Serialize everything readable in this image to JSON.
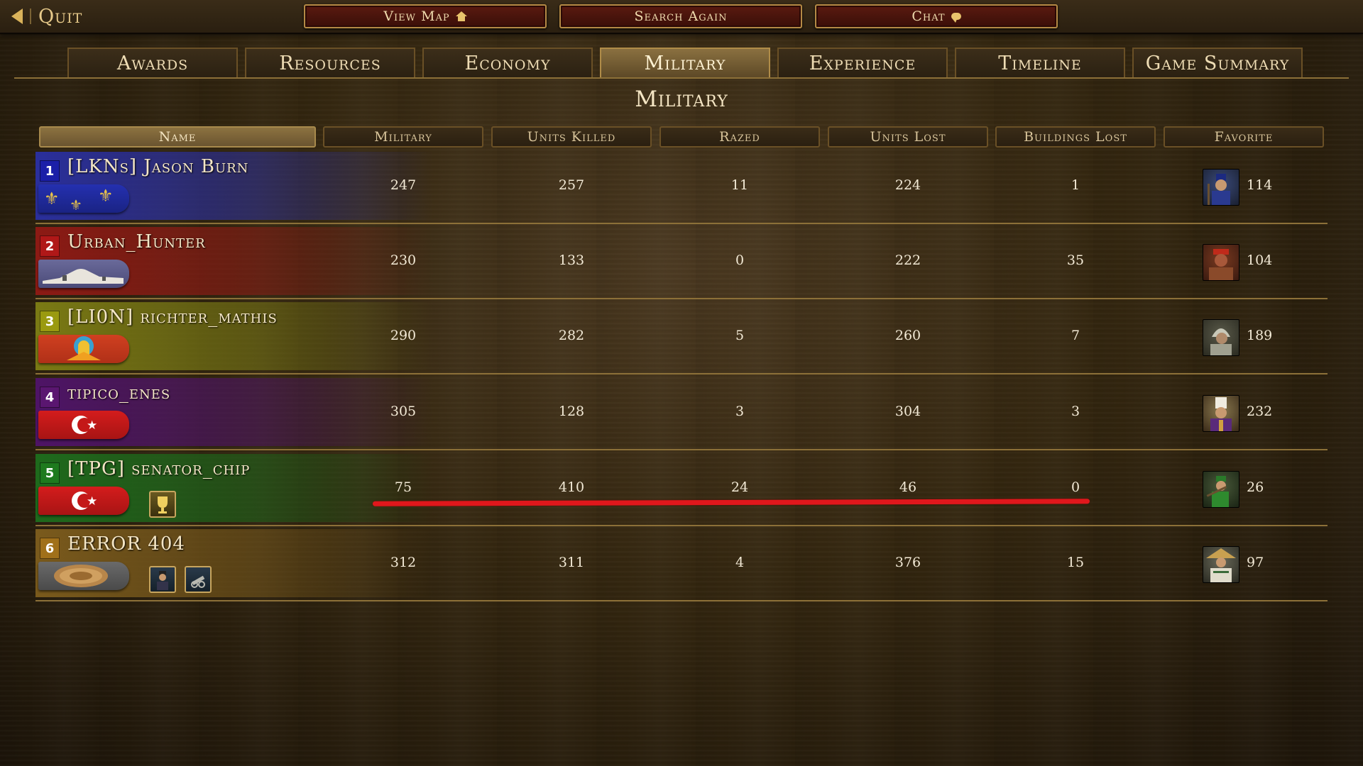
{
  "topbar": {
    "quit_label": "Quit",
    "view_map_label": "View Map",
    "search_again_label": "Search Again",
    "chat_label": "Chat"
  },
  "tabs": [
    {
      "label": "Awards"
    },
    {
      "label": "Resources"
    },
    {
      "label": "Economy"
    },
    {
      "label": "Military",
      "active": true
    },
    {
      "label": "Experience"
    },
    {
      "label": "Timeline"
    },
    {
      "label": "Game Summary"
    }
  ],
  "page_title": "Military",
  "table": {
    "headers": [
      "Name",
      "Military",
      "Units Killed",
      "Razed",
      "Units Lost",
      "Buildings Lost",
      "Favorite"
    ],
    "rows": [
      {
        "rank": "1",
        "name": "[LKNs] Jason Burn",
        "rank_color": "#1b1fa8",
        "band_color": "#2a2f9c",
        "flag": "fleur-de-lis-flag",
        "military": "247",
        "units_killed": "257",
        "razed": "11",
        "units_lost": "224",
        "buildings_lost": "1",
        "favorite_icon": "musketeer-portrait-icon",
        "favorite_count": "114"
      },
      {
        "rank": "2",
        "name": "Urban_Hunter",
        "rank_color": "#b01818",
        "band_color": "#8c1a14",
        "flag": "desert-fortress-flag",
        "military": "230",
        "units_killed": "133",
        "razed": "0",
        "units_lost": "222",
        "buildings_lost": "35",
        "favorite_icon": "warrior-portrait-icon",
        "favorite_count": "104"
      },
      {
        "rank": "3",
        "name": "[LI0N] richter_mathis",
        "rank_color": "#9a9a10",
        "band_color": "#7a7a14",
        "flag": "sun-emblem-flag",
        "military": "290",
        "units_killed": "282",
        "razed": "5",
        "units_lost": "260",
        "buildings_lost": "7",
        "favorite_icon": "armored-soldier-portrait-icon",
        "favorite_count": "189"
      },
      {
        "rank": "4",
        "name": "tipico_enes",
        "rank_color": "#5a1670",
        "band_color": "#4e1466",
        "flag": "crescent-star-flag",
        "military": "305",
        "units_killed": "128",
        "razed": "3",
        "units_lost": "304",
        "buildings_lost": "3",
        "favorite_icon": "janissary-portrait-icon",
        "favorite_count": "232"
      },
      {
        "rank": "5",
        "name": "[TPG] senator_chip",
        "rank_color": "#1e7a1e",
        "band_color": "#1e6a1c",
        "flag": "crescent-star-flag",
        "military": "75",
        "units_killed": "410",
        "razed": "24",
        "units_lost": "46",
        "buildings_lost": "0",
        "favorite_icon": "green-rifleman-portrait-icon",
        "favorite_count": "26",
        "badges": [
          "trophy-icon"
        ]
      },
      {
        "rank": "6",
        "name": "ERROR 404",
        "rank_color": "#a0701a",
        "band_color": "#7a5a1c",
        "flag": "ornate-shield-flag",
        "military": "312",
        "units_killed": "311",
        "razed": "4",
        "units_lost": "376",
        "buildings_lost": "15",
        "favorite_icon": "conical-hat-soldier-portrait-icon",
        "favorite_count": "97",
        "badges": [
          "officer-portrait-icon",
          "cannon-icon"
        ]
      }
    ]
  },
  "colors": {
    "accent_gold": "#b48a45",
    "button_red": "#5a1a10",
    "annotation_red": "#e0171c"
  }
}
